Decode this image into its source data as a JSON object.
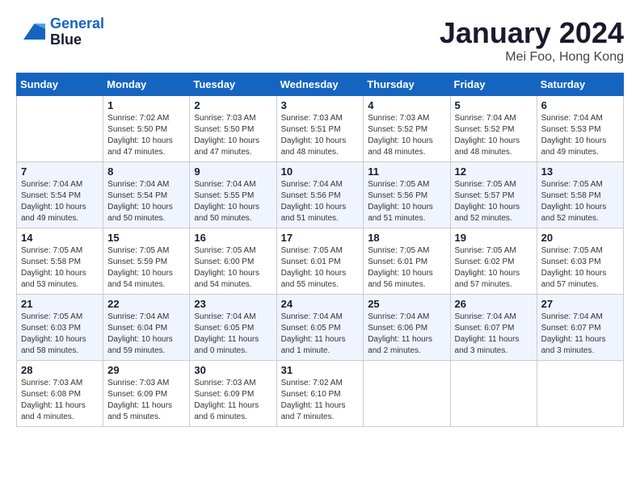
{
  "header": {
    "logo_line1": "General",
    "logo_line2": "Blue",
    "month_title": "January 2024",
    "location": "Mei Foo, Hong Kong"
  },
  "weekdays": [
    "Sunday",
    "Monday",
    "Tuesday",
    "Wednesday",
    "Thursday",
    "Friday",
    "Saturday"
  ],
  "weeks": [
    [
      {
        "day": "",
        "sunrise": "",
        "sunset": "",
        "daylight": ""
      },
      {
        "day": "1",
        "sunrise": "Sunrise: 7:02 AM",
        "sunset": "Sunset: 5:50 PM",
        "daylight": "Daylight: 10 hours and 47 minutes."
      },
      {
        "day": "2",
        "sunrise": "Sunrise: 7:03 AM",
        "sunset": "Sunset: 5:50 PM",
        "daylight": "Daylight: 10 hours and 47 minutes."
      },
      {
        "day": "3",
        "sunrise": "Sunrise: 7:03 AM",
        "sunset": "Sunset: 5:51 PM",
        "daylight": "Daylight: 10 hours and 48 minutes."
      },
      {
        "day": "4",
        "sunrise": "Sunrise: 7:03 AM",
        "sunset": "Sunset: 5:52 PM",
        "daylight": "Daylight: 10 hours and 48 minutes."
      },
      {
        "day": "5",
        "sunrise": "Sunrise: 7:04 AM",
        "sunset": "Sunset: 5:52 PM",
        "daylight": "Daylight: 10 hours and 48 minutes."
      },
      {
        "day": "6",
        "sunrise": "Sunrise: 7:04 AM",
        "sunset": "Sunset: 5:53 PM",
        "daylight": "Daylight: 10 hours and 49 minutes."
      }
    ],
    [
      {
        "day": "7",
        "sunrise": "Sunrise: 7:04 AM",
        "sunset": "Sunset: 5:54 PM",
        "daylight": "Daylight: 10 hours and 49 minutes."
      },
      {
        "day": "8",
        "sunrise": "Sunrise: 7:04 AM",
        "sunset": "Sunset: 5:54 PM",
        "daylight": "Daylight: 10 hours and 50 minutes."
      },
      {
        "day": "9",
        "sunrise": "Sunrise: 7:04 AM",
        "sunset": "Sunset: 5:55 PM",
        "daylight": "Daylight: 10 hours and 50 minutes."
      },
      {
        "day": "10",
        "sunrise": "Sunrise: 7:04 AM",
        "sunset": "Sunset: 5:56 PM",
        "daylight": "Daylight: 10 hours and 51 minutes."
      },
      {
        "day": "11",
        "sunrise": "Sunrise: 7:05 AM",
        "sunset": "Sunset: 5:56 PM",
        "daylight": "Daylight: 10 hours and 51 minutes."
      },
      {
        "day": "12",
        "sunrise": "Sunrise: 7:05 AM",
        "sunset": "Sunset: 5:57 PM",
        "daylight": "Daylight: 10 hours and 52 minutes."
      },
      {
        "day": "13",
        "sunrise": "Sunrise: 7:05 AM",
        "sunset": "Sunset: 5:58 PM",
        "daylight": "Daylight: 10 hours and 52 minutes."
      }
    ],
    [
      {
        "day": "14",
        "sunrise": "Sunrise: 7:05 AM",
        "sunset": "Sunset: 5:58 PM",
        "daylight": "Daylight: 10 hours and 53 minutes."
      },
      {
        "day": "15",
        "sunrise": "Sunrise: 7:05 AM",
        "sunset": "Sunset: 5:59 PM",
        "daylight": "Daylight: 10 hours and 54 minutes."
      },
      {
        "day": "16",
        "sunrise": "Sunrise: 7:05 AM",
        "sunset": "Sunset: 6:00 PM",
        "daylight": "Daylight: 10 hours and 54 minutes."
      },
      {
        "day": "17",
        "sunrise": "Sunrise: 7:05 AM",
        "sunset": "Sunset: 6:01 PM",
        "daylight": "Daylight: 10 hours and 55 minutes."
      },
      {
        "day": "18",
        "sunrise": "Sunrise: 7:05 AM",
        "sunset": "Sunset: 6:01 PM",
        "daylight": "Daylight: 10 hours and 56 minutes."
      },
      {
        "day": "19",
        "sunrise": "Sunrise: 7:05 AM",
        "sunset": "Sunset: 6:02 PM",
        "daylight": "Daylight: 10 hours and 57 minutes."
      },
      {
        "day": "20",
        "sunrise": "Sunrise: 7:05 AM",
        "sunset": "Sunset: 6:03 PM",
        "daylight": "Daylight: 10 hours and 57 minutes."
      }
    ],
    [
      {
        "day": "21",
        "sunrise": "Sunrise: 7:05 AM",
        "sunset": "Sunset: 6:03 PM",
        "daylight": "Daylight: 10 hours and 58 minutes."
      },
      {
        "day": "22",
        "sunrise": "Sunrise: 7:04 AM",
        "sunset": "Sunset: 6:04 PM",
        "daylight": "Daylight: 10 hours and 59 minutes."
      },
      {
        "day": "23",
        "sunrise": "Sunrise: 7:04 AM",
        "sunset": "Sunset: 6:05 PM",
        "daylight": "Daylight: 11 hours and 0 minutes."
      },
      {
        "day": "24",
        "sunrise": "Sunrise: 7:04 AM",
        "sunset": "Sunset: 6:05 PM",
        "daylight": "Daylight: 11 hours and 1 minute."
      },
      {
        "day": "25",
        "sunrise": "Sunrise: 7:04 AM",
        "sunset": "Sunset: 6:06 PM",
        "daylight": "Daylight: 11 hours and 2 minutes."
      },
      {
        "day": "26",
        "sunrise": "Sunrise: 7:04 AM",
        "sunset": "Sunset: 6:07 PM",
        "daylight": "Daylight: 11 hours and 3 minutes."
      },
      {
        "day": "27",
        "sunrise": "Sunrise: 7:04 AM",
        "sunset": "Sunset: 6:07 PM",
        "daylight": "Daylight: 11 hours and 3 minutes."
      }
    ],
    [
      {
        "day": "28",
        "sunrise": "Sunrise: 7:03 AM",
        "sunset": "Sunset: 6:08 PM",
        "daylight": "Daylight: 11 hours and 4 minutes."
      },
      {
        "day": "29",
        "sunrise": "Sunrise: 7:03 AM",
        "sunset": "Sunset: 6:09 PM",
        "daylight": "Daylight: 11 hours and 5 minutes."
      },
      {
        "day": "30",
        "sunrise": "Sunrise: 7:03 AM",
        "sunset": "Sunset: 6:09 PM",
        "daylight": "Daylight: 11 hours and 6 minutes."
      },
      {
        "day": "31",
        "sunrise": "Sunrise: 7:02 AM",
        "sunset": "Sunset: 6:10 PM",
        "daylight": "Daylight: 11 hours and 7 minutes."
      },
      {
        "day": "",
        "sunrise": "",
        "sunset": "",
        "daylight": ""
      },
      {
        "day": "",
        "sunrise": "",
        "sunset": "",
        "daylight": ""
      },
      {
        "day": "",
        "sunrise": "",
        "sunset": "",
        "daylight": ""
      }
    ]
  ]
}
